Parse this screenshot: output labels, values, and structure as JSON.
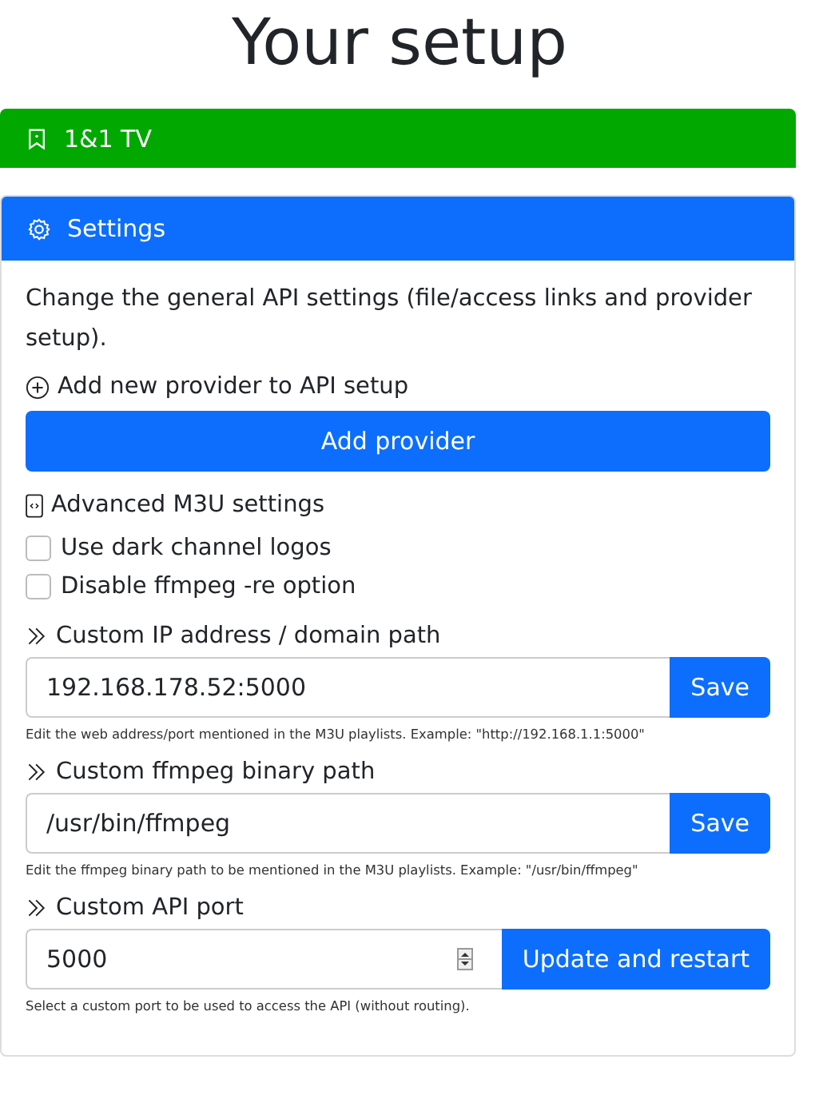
{
  "title": "Your setup",
  "provider_bar": {
    "label": "1&1 TV"
  },
  "settings": {
    "header": "Settings",
    "description": "Change the general API settings (file/access links and provider setup).",
    "add_section": {
      "label": "Add new provider to API setup",
      "button": "Add provider"
    },
    "advanced": {
      "label": "Advanced M3U settings",
      "checkboxes": [
        {
          "label": "Use dark channel logos",
          "checked": false
        },
        {
          "label": "Disable ffmpeg -re option",
          "checked": false
        }
      ]
    },
    "fields": [
      {
        "label": "Custom IP address / domain path",
        "kind": "text",
        "value": "192.168.178.52:5000",
        "button": "Save",
        "help": "Edit the web address/port mentioned in the M3U playlists. Example: \"http://192.168.1.1:5000\""
      },
      {
        "label": "Custom ffmpeg binary path",
        "kind": "text",
        "value": "/usr/bin/ffmpeg",
        "button": "Save",
        "help": "Edit the ffmpeg binary path to be mentioned in the M3U playlists. Example: \"/usr/bin/ffmpeg\""
      },
      {
        "label": "Custom API port",
        "kind": "number",
        "value": "5000",
        "button": "Update and restart",
        "help": "Select a custom port to be used to access the API (without routing)."
      }
    ]
  }
}
